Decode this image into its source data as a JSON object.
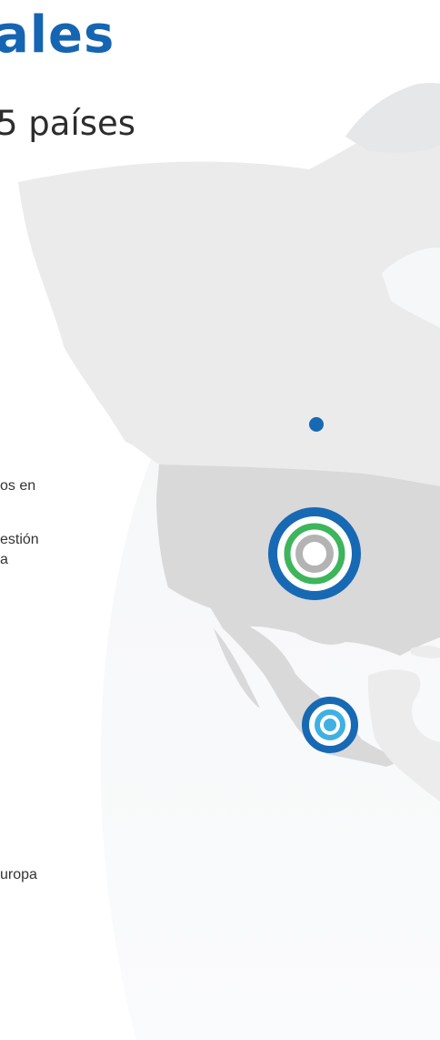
{
  "header": {
    "title": "ales",
    "subtitle": "5 países"
  },
  "body_fragments": [
    "os en",
    "estión",
    "a",
    "uropa"
  ],
  "colors": {
    "title": "#1565b3",
    "subtitle_text": "#2d2d2d",
    "land_north": "#ebebec",
    "land_highlight": "#d9d9da",
    "ring_blue": "#1769b4",
    "ring_green": "#3cb55b",
    "ring_gray": "#b3b3b3",
    "dot_light_blue": "#3fb0e4"
  },
  "markers": [
    {
      "id": "canada-dot",
      "type": "dot",
      "color": "#1769b4"
    },
    {
      "id": "usa-rings",
      "type": "concentric-rings",
      "colors": [
        "#1769b4",
        "#3cb55b",
        "#b3b3b3"
      ]
    },
    {
      "id": "mexico-rings",
      "type": "concentric-rings",
      "colors": [
        "#1769b4",
        "#3fb0e4"
      ]
    }
  ]
}
